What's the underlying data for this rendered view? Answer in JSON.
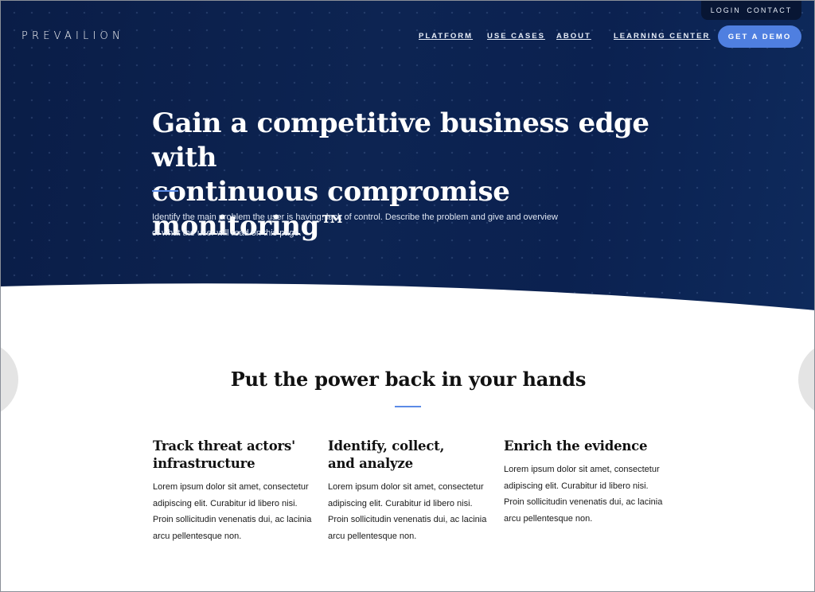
{
  "topbar": {
    "login": "LOGIN",
    "contact": "CONTACT"
  },
  "brand": {
    "logo_text": "PREVAILION"
  },
  "nav": {
    "items": [
      {
        "label": "PLATFORM"
      },
      {
        "label": "USE CASES"
      },
      {
        "label": "ABOUT"
      },
      {
        "label": "LEARNING CENTER"
      }
    ],
    "cta_label": "GET A DEMO"
  },
  "hero": {
    "title_line1": "Gain a competitive business edge with",
    "title_line2": "continuous compromise monitoring™",
    "text": "Identify the main problem the user is having: lack of control. Describe the problem and give and overview of what the user will read on this page."
  },
  "section": {
    "title": "Put the power back in your hands",
    "features": [
      {
        "title_line1": "Track threat actors'",
        "title_line2": "infrastructure",
        "body": "Lorem ipsum dolor sit amet, consectetur adipiscing elit. Curabitur id libero nisi. Proin sollicitudin venenatis dui, ac lacinia arcu pellentesque non."
      },
      {
        "title_line1": "Identify, collect,",
        "title_line2": "and analyze",
        "body": "Lorem ipsum dolor sit amet, consectetur adipiscing elit. Curabitur id libero nisi. Proin sollicitudin venenatis dui, ac lacinia arcu pellentesque non."
      },
      {
        "title_line1": "Enrich the evidence",
        "body": "Lorem ipsum dolor sit amet, consectetur adipiscing elit. Curabitur id libero nisi. Proin sollicitudin venenatis dui, ac lacinia arcu pellentesque non."
      }
    ]
  },
  "colors": {
    "hero_bg": "#0d2452",
    "accent": "#4f7fe0",
    "rule": "#5b8be6",
    "topbar_bg": "#081634"
  }
}
